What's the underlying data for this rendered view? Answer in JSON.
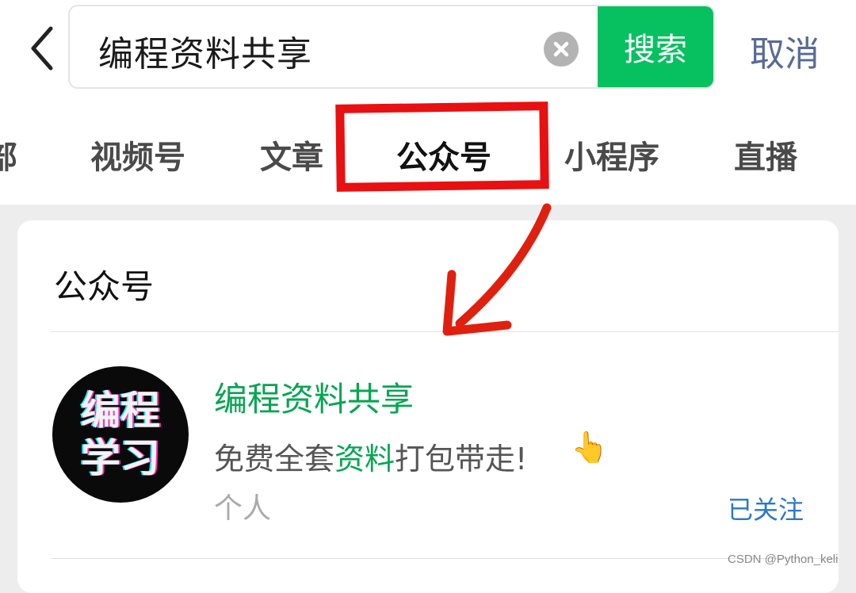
{
  "search": {
    "query": "编程资料共享",
    "button_label": "搜索",
    "cancel_label": "取消"
  },
  "tabs": [
    {
      "label": "部",
      "active": false
    },
    {
      "label": "视频号",
      "active": false
    },
    {
      "label": "文章",
      "active": false
    },
    {
      "label": "公众号",
      "active": true
    },
    {
      "label": "小程序",
      "active": false
    },
    {
      "label": "直播",
      "active": false
    }
  ],
  "results": {
    "section_title": "公众号",
    "account": {
      "avatar_text": [
        "编程",
        "学习"
      ],
      "name": "编程资料共享",
      "desc_prefix": "免费全套",
      "desc_highlight": "资料",
      "desc_suffix": "打包带走!",
      "type": "个人",
      "follow_label": "已关注"
    }
  },
  "watermark": "CSDN @Python_keli",
  "colors": {
    "accent_green": "#07c160",
    "link_blue": "#576b95",
    "annotation_red": "#e81010"
  },
  "icons": [
    "chevron-left-icon",
    "clear-icon",
    "pointing-hand-icon"
  ]
}
